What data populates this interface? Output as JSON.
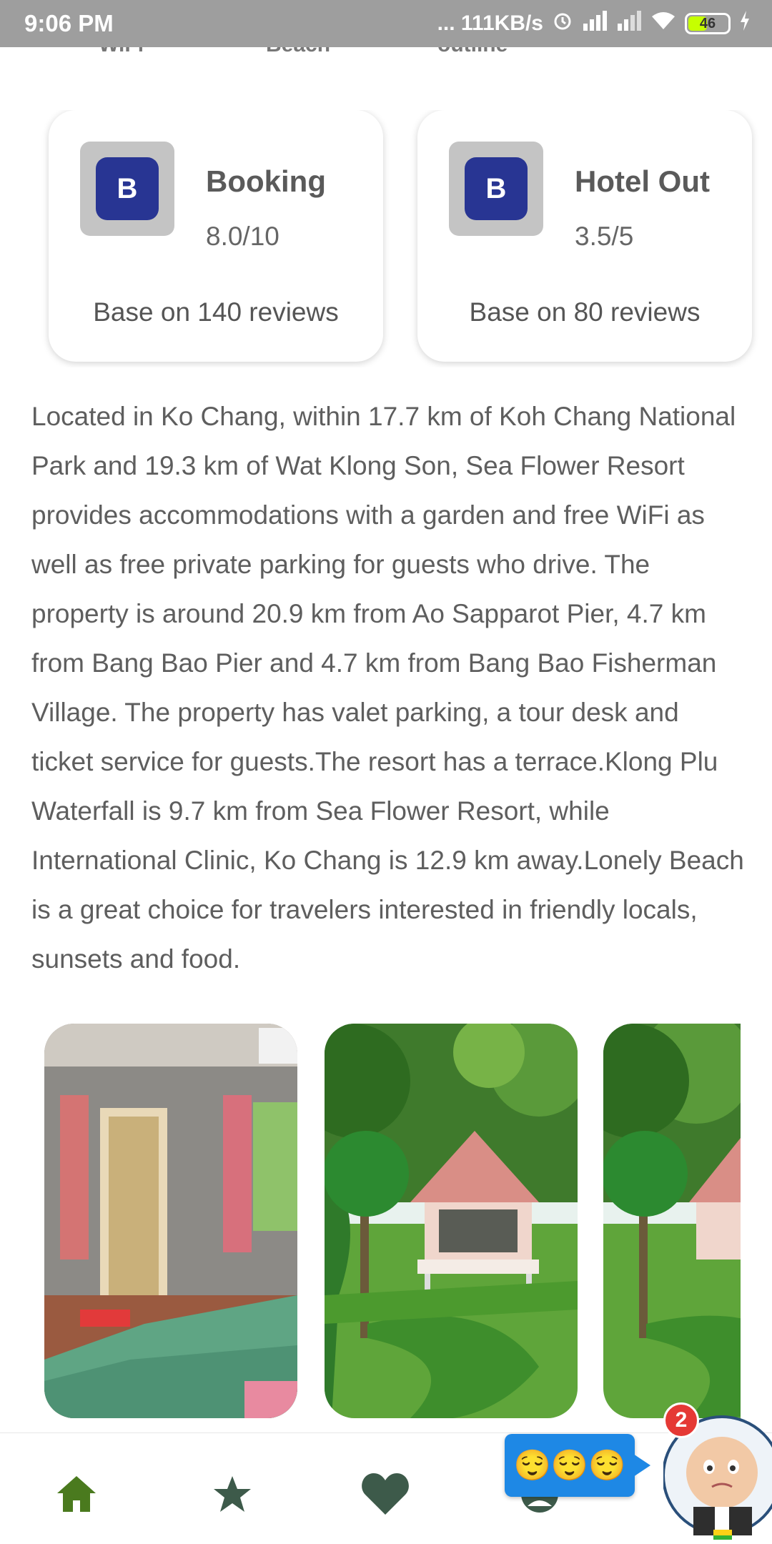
{
  "status_bar": {
    "time": "9:06 PM",
    "network_speed": "... 111KB/s",
    "battery": "46",
    "icons": [
      "alarm-icon",
      "signal-icon",
      "signal-icon-2",
      "wifi-icon",
      "battery-icon",
      "charging-icon"
    ]
  },
  "categories": [
    "WiFi",
    "Beach",
    "outline",
    ""
  ],
  "ratings": [
    {
      "logo": "B",
      "name": "Booking",
      "score": "8.0/10",
      "reviews": "Base on 140 reviews"
    },
    {
      "logo": "B",
      "name": "Hotel Out",
      "score": "3.5/5",
      "reviews": "Base on 80 reviews"
    }
  ],
  "description": "Located in Ko Chang, within 17.7 km of Koh Chang National Park and 19.3 km of Wat Klong Son, Sea Flower Resort provides accommodations with a garden and free WiFi as well as free private parking for guests who drive. The property is around 20.9 km from Ao Sapparot Pier, 4.7 km from Bang Bao Pier and 4.7 km from Bang Bao Fisherman Village. The property has valet parking, a tour desk and ticket service for guests.The resort has a terrace.Klong Plu Waterfall is 9.7 km from Sea Flower Resort, while International Clinic, Ko Chang is 12.9 km away.Lonely Beach is a great choice for travelers interested in friendly locals, sunsets and food.",
  "gallery": [
    "room-photo",
    "bungalow-photo",
    "bungalow-photo-2"
  ],
  "bottom_nav": [
    "home-icon",
    "star-icon",
    "heart-icon",
    "user-icon"
  ],
  "chat": {
    "bubble_text": "😌😌😌",
    "badge_count": "2"
  },
  "colors": {
    "nav_active": "#4a7a1e",
    "nav_inactive": "#3d5a4a",
    "logo_bg": "#283593",
    "chat_bubble": "#1e88e5",
    "badge": "#e53935"
  }
}
